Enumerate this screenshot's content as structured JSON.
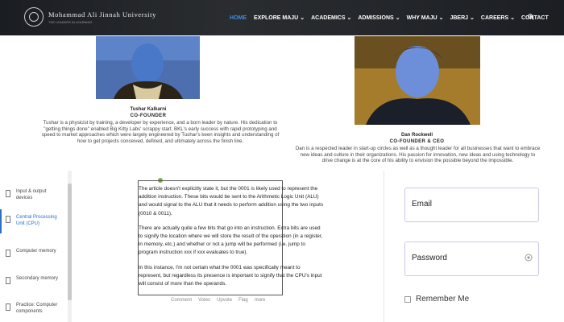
{
  "header": {
    "university_name": "Mohammad Ali Jinnah University",
    "university_sub": "THE LEADERS IN LEARNING",
    "nav": [
      {
        "label": "HOME",
        "active": true,
        "caret": false
      },
      {
        "label": "EXPLORE MAJU",
        "active": false,
        "caret": true
      },
      {
        "label": "ACADEMICS",
        "active": false,
        "caret": true
      },
      {
        "label": "ADMISSIONS",
        "active": false,
        "caret": true
      },
      {
        "label": "WHY MAJU",
        "active": false,
        "caret": true
      },
      {
        "label": "JBERJ",
        "active": false,
        "caret": true
      },
      {
        "label": "CAREERS",
        "active": false,
        "caret": true
      },
      {
        "label": "CONTACT",
        "active": false,
        "caret": false
      }
    ],
    "accent_color": "#3d8ee8"
  },
  "founders": [
    {
      "name": "Tushar Kalkarni",
      "role": "CO-FOUNDER",
      "bio": "Tushar is a physicist by training, a developer by experience, and a born leader by nature. His dedication to \"getting things done\" enabled Big Kitty Labs' scrappy start. BKL's early success with rapid prototyping and speed to market approaches which were largely engineered by Tushar's keen insights and understanding of how to get projects conceived, defined, and ultimately across the finish line."
    },
    {
      "name": "Dan Rockwell",
      "role": "CO-FOUNDER & CEO",
      "bio": "Dan is a respected leader in start-up circles as well as a thought leader for all businesses that want to embrace new ideas and culture in their organizations. His passion for innovation, new ideas and using technology to drive change is at the core of his ability to envision the possible beyond the impossible."
    }
  ],
  "sidebar": {
    "items": [
      {
        "label": "Input & output devices",
        "active": false
      },
      {
        "label": "Central Processing Unit (CPU)",
        "active": true
      },
      {
        "label": "Computer memory",
        "active": false
      },
      {
        "label": "Secondary memory",
        "active": false
      },
      {
        "label": "Practice: Computer components",
        "active": false
      }
    ]
  },
  "article": {
    "paragraphs": [
      "The article doesn't explicitly state it, but the 0001 is likely used to represent the addition instruction. These bits would be sent to the Arithmetic Logic Unit (ALU) and would signal to the ALU that it needs to perform addition using the two inputs (0010 & 0011).",
      "There are actually quite a few bits that go into an instruction. Extra bits are used to signify the location where we will store the result of the operation (in a register, in memory, etc.) and whether or not a jump will be performed (i.e. jump to program instruction xxx if xxx evaluates to true).",
      "In this instance, I'm not certain what the 0001 was specifically meant to represent, but regardless its presence is important to signify that the CPU's input will consist of more than the operands."
    ],
    "comment_bar": [
      "Comment",
      "Votes",
      "Upvote",
      "Flag",
      "more"
    ]
  },
  "login": {
    "email_placeholder": "Email",
    "password_placeholder": "Password",
    "remember_label": "Remember Me"
  }
}
